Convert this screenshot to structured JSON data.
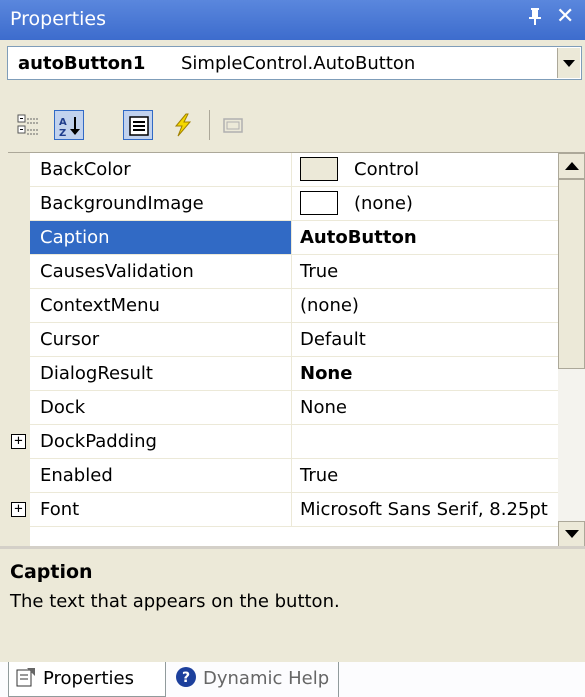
{
  "window": {
    "title": "Properties",
    "pin_label": "ᵖ",
    "close_label": "✕"
  },
  "object_selector": {
    "name": "autoButton1",
    "type": "SimpleControl.AutoButton"
  },
  "toolbar": {
    "buttons": [
      "categorized-icon",
      "alphabetical-icon",
      "properties-icon",
      "events-icon",
      "property-pages-icon"
    ]
  },
  "grid": {
    "rows": [
      {
        "name": "BackColor",
        "value": "Control",
        "swatch": "#ece9d8"
      },
      {
        "name": "BackgroundImage",
        "value": "(none)",
        "swatch": "#ffffff"
      },
      {
        "name": "Caption",
        "value": "AutoButton",
        "bold": true,
        "selected": true
      },
      {
        "name": "CausesValidation",
        "value": "True"
      },
      {
        "name": "ContextMenu",
        "value": "(none)"
      },
      {
        "name": "Cursor",
        "value": "Default"
      },
      {
        "name": "DialogResult",
        "value": "None",
        "bold": true
      },
      {
        "name": "Dock",
        "value": "None"
      },
      {
        "name": "DockPadding",
        "value": "",
        "expandable": true
      },
      {
        "name": "Enabled",
        "value": "True"
      },
      {
        "name": "Font",
        "value": "Microsoft Sans Serif, 8.25pt",
        "expandable": true
      }
    ]
  },
  "description": {
    "title": "Caption",
    "text": "The text that appears on the button."
  },
  "tabs": [
    {
      "label": "Properties",
      "active": true
    },
    {
      "label": "Dynamic Help",
      "active": false
    }
  ],
  "colors": {
    "titlebar": "#3d6ccd",
    "selection": "#316ac5",
    "chrome": "#ece9d8"
  }
}
